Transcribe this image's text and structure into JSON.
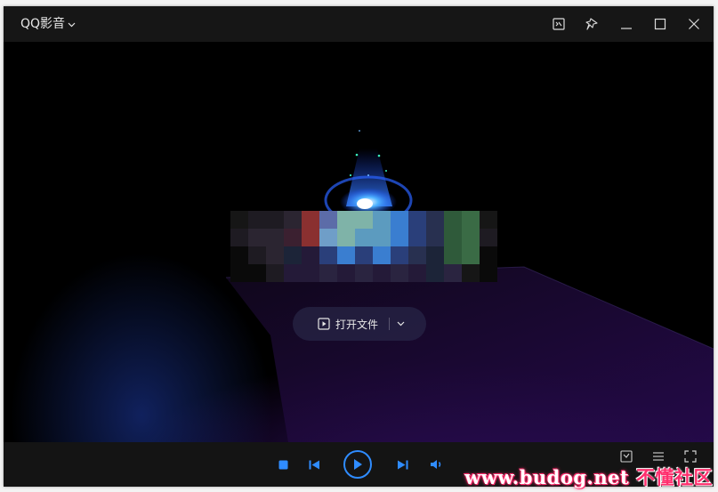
{
  "titlebar": {
    "app_name": "QQ影音",
    "icons": [
      "screenshot-icon",
      "pin-icon",
      "minimize-icon",
      "maximize-icon",
      "close-icon"
    ]
  },
  "stage": {
    "open_file_label": "打开文件",
    "open_file_icon": "video-file-icon",
    "dropdown_icon": "chevron-down-icon"
  },
  "controls": {
    "buttons": [
      "stop-icon",
      "previous-icon",
      "play-icon",
      "next-icon",
      "volume-icon"
    ],
    "right_icons": [
      "toolbox-icon",
      "settings-icon",
      "fullscreen-icon"
    ]
  },
  "watermark": {
    "latin": "www.budog.net",
    "chinese": "不懂社区"
  },
  "colors": {
    "accent": "#2f8cff",
    "titlebar_bg": "#161616",
    "controlbar_bg": "#141414",
    "watermark": "#ff2f6e"
  }
}
